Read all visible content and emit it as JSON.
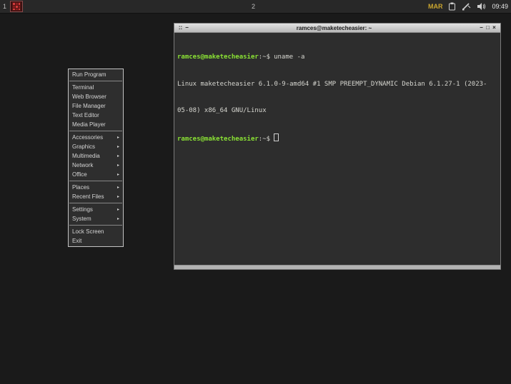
{
  "panel": {
    "workspace1_label": "1",
    "workspace2_label": "2",
    "month": "MAR",
    "time": "09:49"
  },
  "icons": {
    "submenu_arrow": "▸",
    "window_menu": "::",
    "shade": "−",
    "minimize": "−",
    "maximize": "□",
    "close": "×",
    "app_icon": "red-checker-grid",
    "tray": [
      "clipboard-icon",
      "pen-icon",
      "volume-icon"
    ]
  },
  "menu": {
    "items": [
      {
        "label": "Run Program",
        "submenu": false
      },
      {
        "label": "Terminal",
        "submenu": false
      },
      {
        "label": "Web Browser",
        "submenu": false
      },
      {
        "label": "File Manager",
        "submenu": false
      },
      {
        "label": "Text Editor",
        "submenu": false
      },
      {
        "label": "Media Player",
        "submenu": false
      },
      {
        "label": "Accessories",
        "submenu": true
      },
      {
        "label": "Graphics",
        "submenu": true
      },
      {
        "label": "Multimedia",
        "submenu": true
      },
      {
        "label": "Network",
        "submenu": true
      },
      {
        "label": "Office",
        "submenu": true
      },
      {
        "label": "Places",
        "submenu": true
      },
      {
        "label": "Recent Files",
        "submenu": true
      },
      {
        "label": "Settings",
        "submenu": true
      },
      {
        "label": "System",
        "submenu": true
      },
      {
        "label": "Lock Screen",
        "submenu": false
      },
      {
        "label": "Exit",
        "submenu": false
      }
    ]
  },
  "terminal": {
    "title": "ramces@maketecheasier: ~",
    "prompt_user": "ramces@maketecheasier",
    "prompt_symbol": ":~$",
    "command": "uname -a",
    "output_lines": [
      "Linux maketecheasier 6.1.0-9-amd64 #1 SMP PREEMPT_DYNAMIC Debian 6.1.27-1 (2023-",
      "05-08) x86_64 GNU/Linux"
    ]
  },
  "colors": {
    "desktop_bg": "#1a1a1a",
    "panel_bg": "#282828",
    "terminal_bg": "#2d2d2d",
    "prompt_green": "#8ae234",
    "month_yellow": "#c9a52f",
    "titlebar_gray": "#c9c9c9"
  }
}
